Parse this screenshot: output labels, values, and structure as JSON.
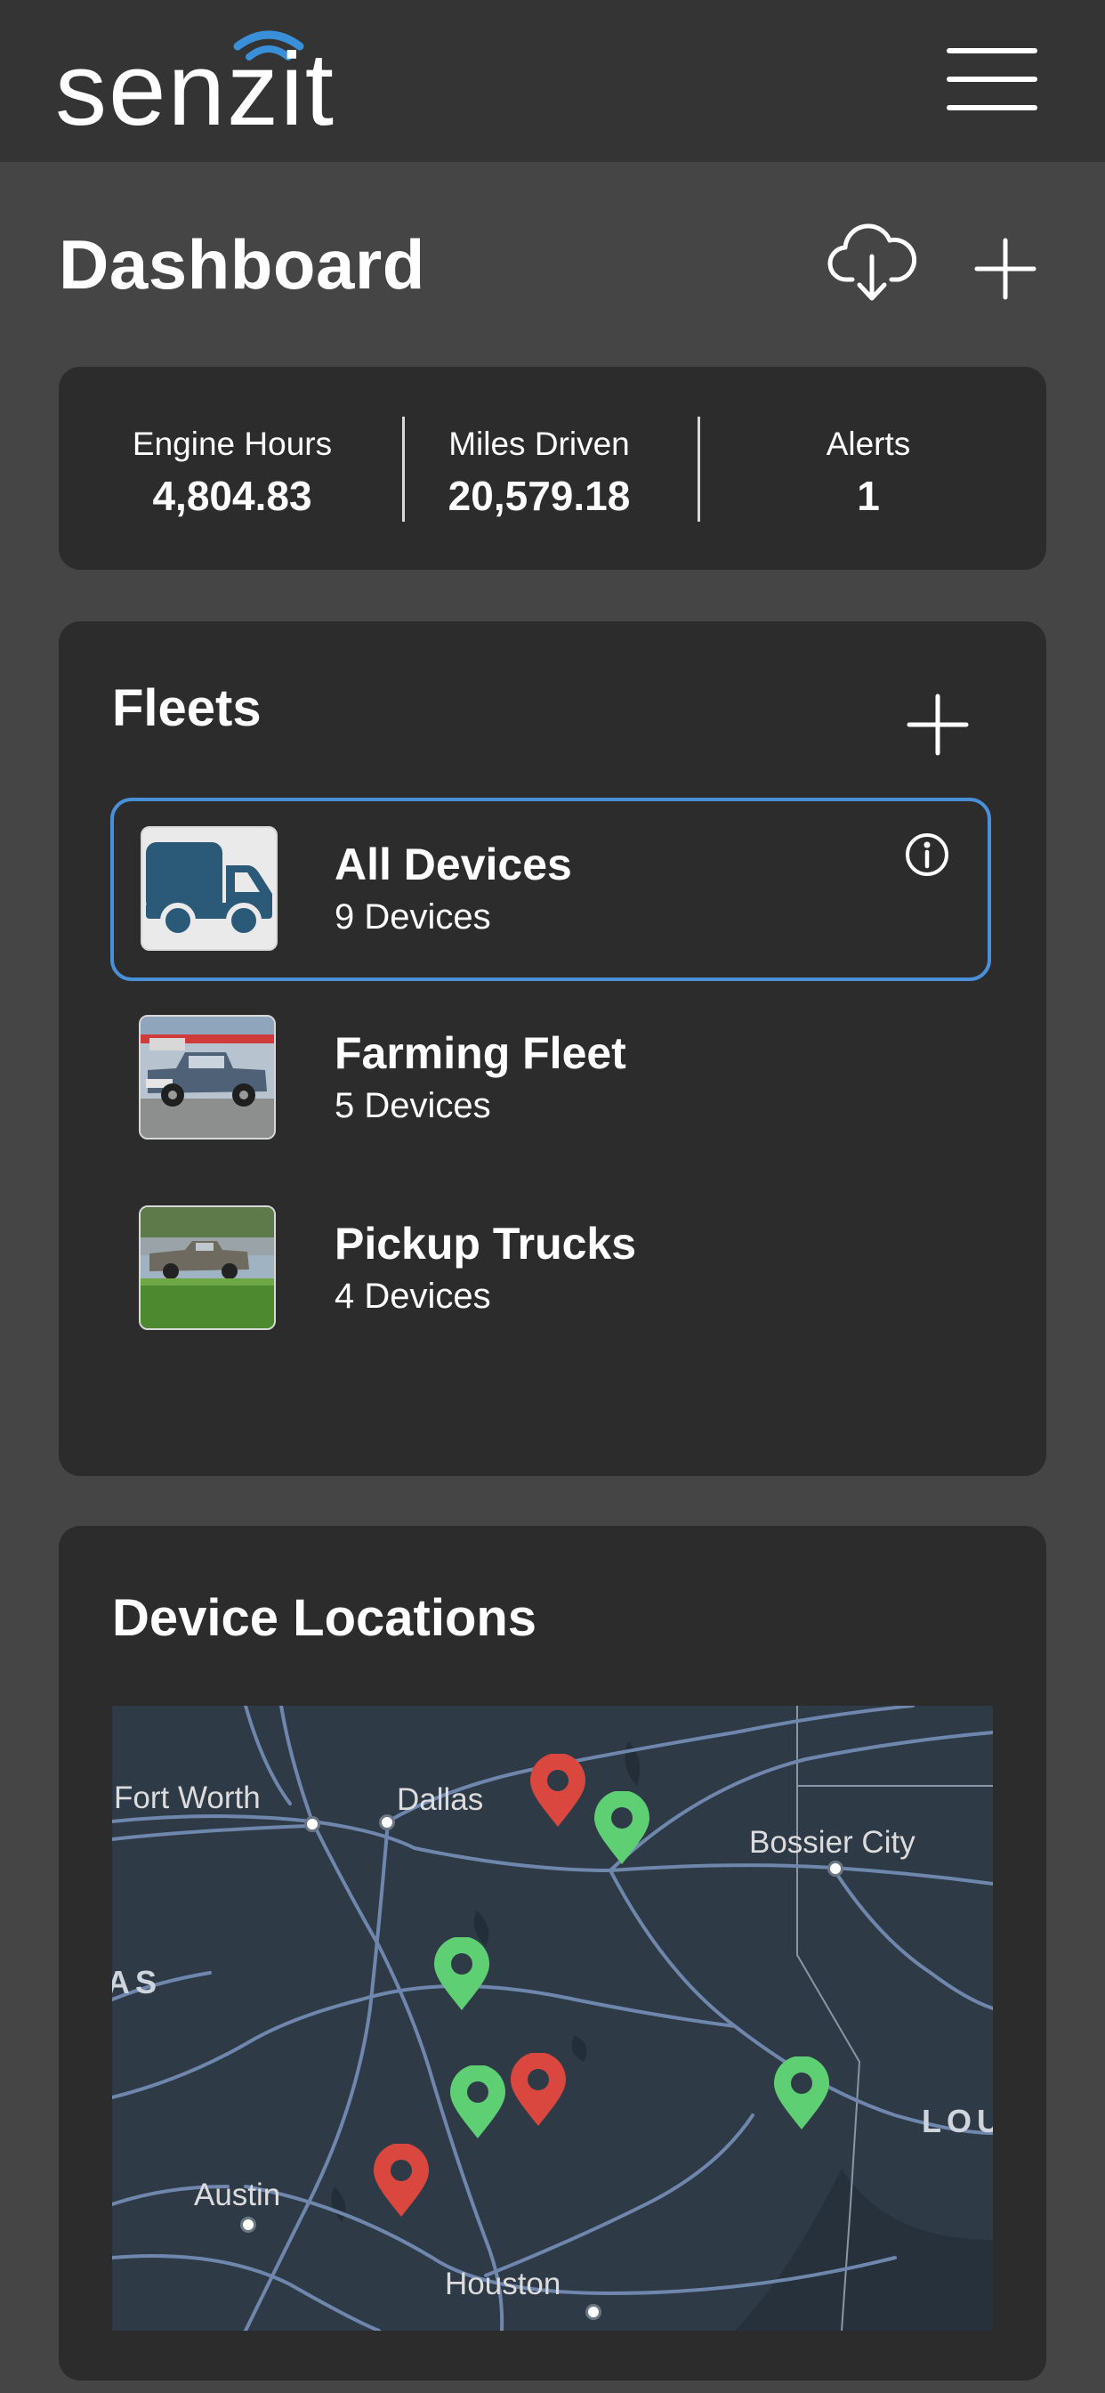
{
  "header": {
    "logo_text": "senzit",
    "menu_icon": "hamburger-menu-icon"
  },
  "page": {
    "title": "Dashboard",
    "download_icon": "cloud-download-icon",
    "add_icon": "plus-icon"
  },
  "stats": [
    {
      "label": "Engine Hours",
      "value": "4,804.83"
    },
    {
      "label": "Miles Driven",
      "value": "20,579.18"
    },
    {
      "label": "Alerts",
      "value": "1"
    }
  ],
  "fleets": {
    "title": "Fleets",
    "add_icon": "plus-icon",
    "items": [
      {
        "name": "All Devices",
        "count": "9 Devices",
        "selected": true,
        "thumb": "truck-icon"
      },
      {
        "name": "Farming Fleet",
        "count": "5 Devices",
        "selected": false,
        "thumb": "pickup-truck-photo"
      },
      {
        "name": "Pickup Trucks",
        "count": "4 Devices",
        "selected": false,
        "thumb": "pickup-truck-field-photo"
      }
    ]
  },
  "locations": {
    "title": "Device Locations",
    "map": {
      "cities": [
        "Fort Worth",
        "Dallas",
        "Bossier City",
        "Austin",
        "Houston"
      ],
      "regions": [
        "AS",
        "LOU"
      ]
    },
    "pins": [
      {
        "status": "alert",
        "color": "#d9473f"
      },
      {
        "status": "ok",
        "color": "#5ecf73"
      },
      {
        "status": "ok",
        "color": "#5ecf73"
      },
      {
        "status": "ok",
        "color": "#5ecf73"
      },
      {
        "status": "alert",
        "color": "#d9473f"
      },
      {
        "status": "ok",
        "color": "#5ecf73"
      },
      {
        "status": "alert",
        "color": "#d9473f"
      }
    ]
  },
  "colors": {
    "background": "#454545",
    "card": "#2c2c2c",
    "topbar": "#343434",
    "accent_blue": "#4a90d9",
    "logo_blue": "#3a8fd9",
    "thumb_truck": "#2a5a78",
    "map_land": "#2f3a47",
    "map_road": "#6f86ad",
    "pin_alert": "#d9473f",
    "pin_ok": "#5ecf73"
  }
}
